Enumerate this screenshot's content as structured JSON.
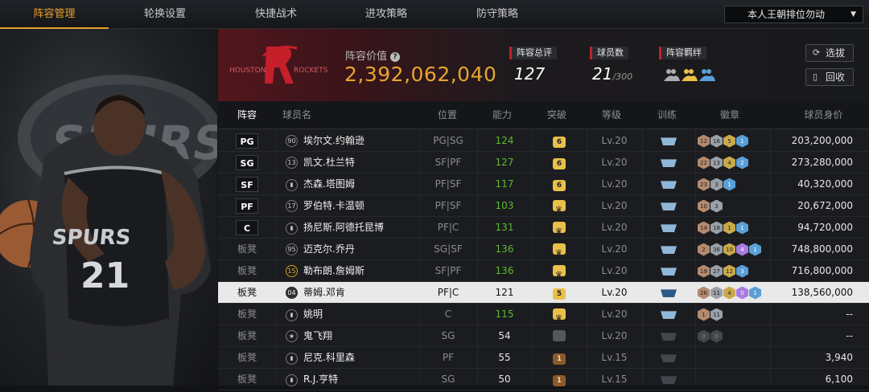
{
  "tabs": [
    "阵容管理",
    "轮换设置",
    "快捷战术",
    "进攻策略",
    "防守策略"
  ],
  "active_tab": 0,
  "mode_dropdown": {
    "value": "本人王朝排位勿动",
    "icon": "chevron-down-icon"
  },
  "team": {
    "logo_text": "HOUSTON ROCKETS",
    "value_label": "阵容价值",
    "value": "2,392,062,040",
    "total_rating_label": "阵容总评",
    "total_rating": "127",
    "player_count_label": "球员数",
    "player_count": "21",
    "player_count_max": "/300",
    "chemistry_label": "阵容羁绊"
  },
  "buttons": {
    "select": "选拔",
    "recycle": "回收"
  },
  "columns": [
    "阵容",
    "球员名",
    "位置",
    "能力",
    "突破",
    "等级",
    "训练",
    "徽章",
    "球员身价"
  ],
  "players": [
    {
      "slot": "PG",
      "num": "90",
      "num_style": "plain",
      "name": "埃尔文.约翰逊",
      "position": "PG|SG",
      "ability": "124",
      "ability_color": "green",
      "breakthrough": "6",
      "break_style": "y",
      "level": "Lv.20",
      "train": "light",
      "badges": [
        [
          "12",
          "h1"
        ],
        [
          "16",
          "h2"
        ],
        [
          "5",
          "h3"
        ],
        [
          "1",
          "h5"
        ]
      ],
      "value": "203,200,000"
    },
    {
      "slot": "SG",
      "num": "13",
      "num_style": "plain",
      "name": "凯文.杜兰特",
      "position": "SF|PF",
      "ability": "127",
      "ability_color": "green",
      "breakthrough": "6",
      "break_style": "y",
      "level": "Lv.20",
      "train": "light",
      "badges": [
        [
          "22",
          "h1"
        ],
        [
          "13",
          "h2"
        ],
        [
          "4",
          "h3"
        ],
        [
          "2",
          "h5"
        ]
      ],
      "value": "273,280,000"
    },
    {
      "slot": "SF",
      "num": "bars",
      "num_style": "bars",
      "name": "杰森.塔图姆",
      "position": "PF|SF",
      "ability": "117",
      "ability_color": "green",
      "breakthrough": "6",
      "break_style": "y",
      "level": "Lv.20",
      "train": "light",
      "badges": [
        [
          "23",
          "h1"
        ],
        [
          "3",
          "h2"
        ],
        [
          "1",
          "h5"
        ]
      ],
      "value": "40,320,000"
    },
    {
      "slot": "PF",
      "num": "17",
      "num_style": "plain",
      "name": "罗伯特.卡温顿",
      "position": "PF|SF",
      "ability": "103",
      "ability_color": "green",
      "breakthrough": "crown",
      "break_style": "crown",
      "level": "Lv.20",
      "train": "light",
      "badges": [
        [
          "10",
          "h1"
        ],
        [
          "3",
          "h2"
        ]
      ],
      "value": "20,672,000"
    },
    {
      "slot": "C",
      "num": "bars",
      "num_style": "bars",
      "name": "扬尼斯.阿德托昆博",
      "position": "PF|C",
      "ability": "131",
      "ability_color": "green",
      "breakthrough": "crown",
      "break_style": "crown",
      "level": "Lv.20",
      "train": "light",
      "badges": [
        [
          "14",
          "h1"
        ],
        [
          "18",
          "h2"
        ],
        [
          "1",
          "h3"
        ],
        [
          "1",
          "h5"
        ]
      ],
      "value": "94,720,000"
    },
    {
      "slot": "板凳",
      "num": "95",
      "num_style": "plain",
      "name": "迈克尔.乔丹",
      "position": "SG|SF",
      "ability": "136",
      "ability_color": "green",
      "breakthrough": "crown",
      "break_style": "crown",
      "level": "Lv.20",
      "train": "light",
      "badges": [
        [
          "2",
          "h1"
        ],
        [
          "36",
          "h2"
        ],
        [
          "10",
          "h3"
        ],
        [
          "4",
          "h4"
        ],
        [
          "1",
          "h5"
        ]
      ],
      "value": "748,800,000"
    },
    {
      "slot": "板凳",
      "num": "15",
      "num_style": "gold",
      "name": "勒布朗.詹姆斯",
      "position": "SF|PF",
      "ability": "136",
      "ability_color": "green",
      "breakthrough": "crown",
      "break_style": "crown",
      "level": "Lv.20",
      "train": "light",
      "badges": [
        [
          "19",
          "h1"
        ],
        [
          "27",
          "h2"
        ],
        [
          "12",
          "h3"
        ],
        [
          "3",
          "h5"
        ]
      ],
      "value": "716,800,000"
    },
    {
      "slot": "板凳",
      "num": "04",
      "num_style": "dark",
      "name": "蒂姆.邓肯",
      "position": "PF|C",
      "ability": "121",
      "ability_color": "dark",
      "breakthrough": "5",
      "break_style": "y",
      "level": "Lv.20",
      "train": "dark",
      "badges": [
        [
          "26",
          "h1"
        ],
        [
          "11",
          "h2"
        ],
        [
          "4",
          "h3"
        ],
        [
          "0",
          "h4"
        ],
        [
          "1",
          "h5"
        ]
      ],
      "value": "138,560,000",
      "selected": true
    },
    {
      "slot": "板凳",
      "num": "bars",
      "num_style": "bars",
      "name": "姚明",
      "position": "C",
      "ability": "115",
      "ability_color": "green",
      "breakthrough": "crown",
      "break_style": "crown",
      "level": "Lv.20",
      "train": "light",
      "badges": [
        [
          "1",
          "h1"
        ],
        [
          "11",
          "h2"
        ]
      ],
      "value": "--"
    },
    {
      "slot": "板凳",
      "num": "star",
      "num_style": "star",
      "name": "鬼飞翔",
      "position": "SG",
      "ability": "54",
      "ability_color": "white",
      "breakthrough": "",
      "break_style": "g",
      "level": "Lv.20",
      "train": "dark",
      "badges": [
        [
          "0",
          "h0"
        ],
        [
          "0",
          "h0"
        ]
      ],
      "value": "--"
    },
    {
      "slot": "板凳",
      "num": "bars",
      "num_style": "bars",
      "name": "尼克.科里森",
      "position": "PF",
      "ability": "55",
      "ability_color": "white",
      "breakthrough": "1",
      "break_style": "b",
      "level": "Lv.15",
      "train": "dark",
      "badges": [],
      "value": "3,940"
    },
    {
      "slot": "板凳",
      "num": "bars",
      "num_style": "bars",
      "name": "R.J.亨特",
      "position": "SG",
      "ability": "50",
      "ability_color": "white",
      "breakthrough": "1",
      "break_style": "b",
      "level": "Lv.15",
      "train": "dark",
      "badges": [],
      "value": "6,100"
    }
  ]
}
